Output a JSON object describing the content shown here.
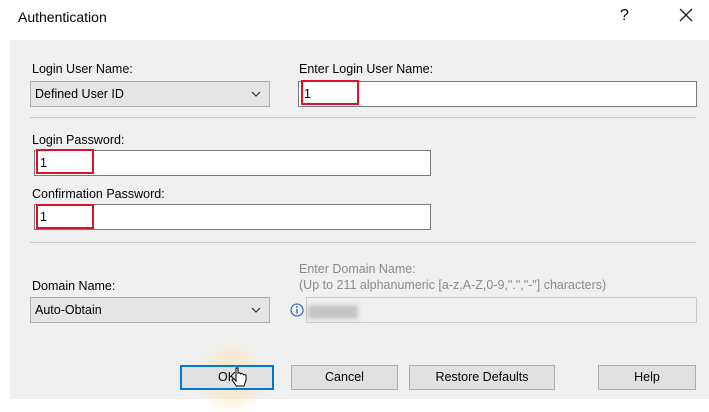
{
  "window": {
    "title": "Authentication",
    "help_glyph": "?",
    "close_icon": "close-icon"
  },
  "login_user_name": {
    "label": "Login User Name:",
    "selected": "Defined User ID",
    "icon": "chevron-down-icon"
  },
  "enter_login_user_name": {
    "label": "Enter Login User Name:",
    "value": "1"
  },
  "login_password": {
    "label": "Login Password:",
    "value": "1"
  },
  "confirmation_password": {
    "label": "Confirmation Password:",
    "value": "1"
  },
  "domain_name": {
    "label": "Domain Name:",
    "selected": "Auto-Obtain",
    "icon": "chevron-down-icon"
  },
  "enter_domain_name": {
    "label": "Enter Domain Name:",
    "hint": "(Up to 211 alphanumeric [a-z,A-Z,0-9,\".\",\"-\"] characters)",
    "info_icon": "info-icon"
  },
  "buttons": {
    "ok": "OK",
    "cancel": "Cancel",
    "restore_defaults": "Restore Defaults",
    "help": "Help"
  },
  "colors": {
    "highlight": "#e0102a",
    "focus": "#0078d7",
    "panel": "#f0f0f0"
  }
}
